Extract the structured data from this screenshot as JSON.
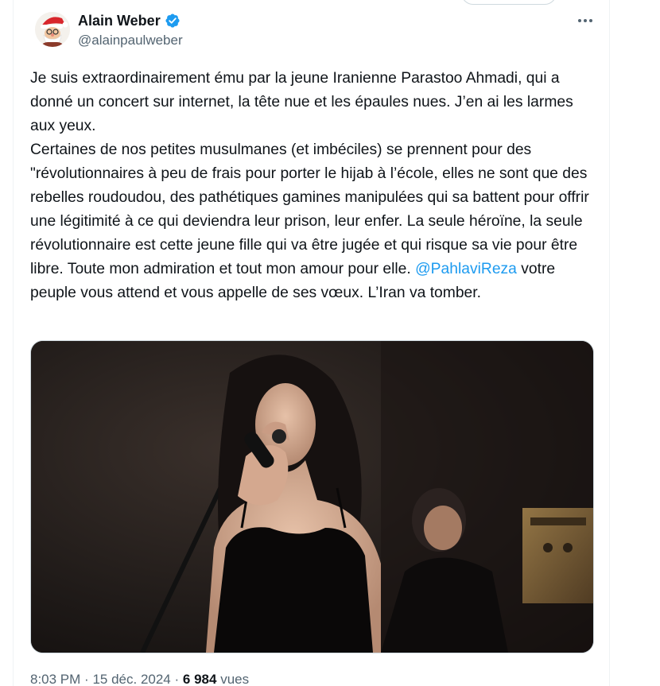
{
  "author": {
    "name": "Alain Weber",
    "handle": "@alainpaulweber",
    "verified": true,
    "avatar_icon": "santa-cartoon-avatar"
  },
  "tweet": {
    "text_part1": "Je suis extraordinairement ému par la jeune Iranienne Parastoo Ahmadi, qui a donné un concert sur internet, la tête nue et les épaules nues. J’en ai les larmes aux yeux.",
    "text_part2": "Certaines de nos petites musulmanes (et imbéciles) se prennent pour des \"révolutionnaires à peu de frais pour porter le hijab à l’école, elles ne sont que des rebelles roudoudou, des pathétiques gamines manipulées qui sa battent pour offrir une légitimité à ce qui deviendra leur prison, leur enfer. La seule héroïne, la seule révolutionnaire est cette jeune fille qui va être jugée et qui risque sa vie pour être libre. Toute mon admiration et tout mon amour pour elle.",
    "mention": "@PahlaviReza",
    "text_part3": "votre peuple vous attend et vous appelle de ses vœux. L’Iran va tomber."
  },
  "meta": {
    "time": "8:03 PM",
    "separator1": "·",
    "date": "15 déc. 2024",
    "separator2": "·",
    "views_count": "6 984",
    "views_label": "vues"
  },
  "colors": {
    "accent": "#1d9bf0",
    "text": "#0f1419",
    "secondary": "#536471"
  },
  "icons": {
    "verified": "verified-badge-icon",
    "more": "more-options-icon"
  }
}
